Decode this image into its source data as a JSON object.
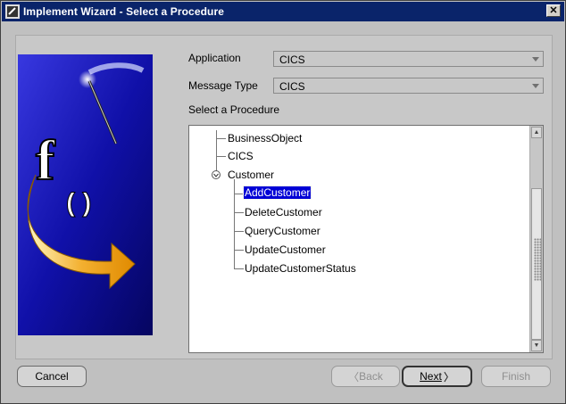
{
  "window": {
    "title": "Implement Wizard - Select a Procedure",
    "close_glyph": "✕"
  },
  "form": {
    "application_label": "Application",
    "application_value": "CICS",
    "message_type_label": "Message Type",
    "message_type_value": "CICS",
    "procedure_label": "Select a Procedure"
  },
  "tree": {
    "items": [
      {
        "label": "BusinessObject"
      },
      {
        "label": "CICS"
      },
      {
        "label": "Customer"
      },
      {
        "label": "AddCustomer"
      },
      {
        "label": "DeleteCustomer"
      },
      {
        "label": "QueryCustomer"
      },
      {
        "label": "UpdateCustomer"
      },
      {
        "label": "UpdateCustomerStatus"
      }
    ],
    "selected": "AddCustomer"
  },
  "buttons": {
    "cancel": "Cancel",
    "back": "Back",
    "next": "Next",
    "finish": "Finish"
  },
  "banner": {
    "glyph": "f",
    "parens": "( )"
  },
  "colors": {
    "titlebar": "#0a246a",
    "selection": "#0000d6",
    "banner_bg": "#1a1ab0"
  }
}
